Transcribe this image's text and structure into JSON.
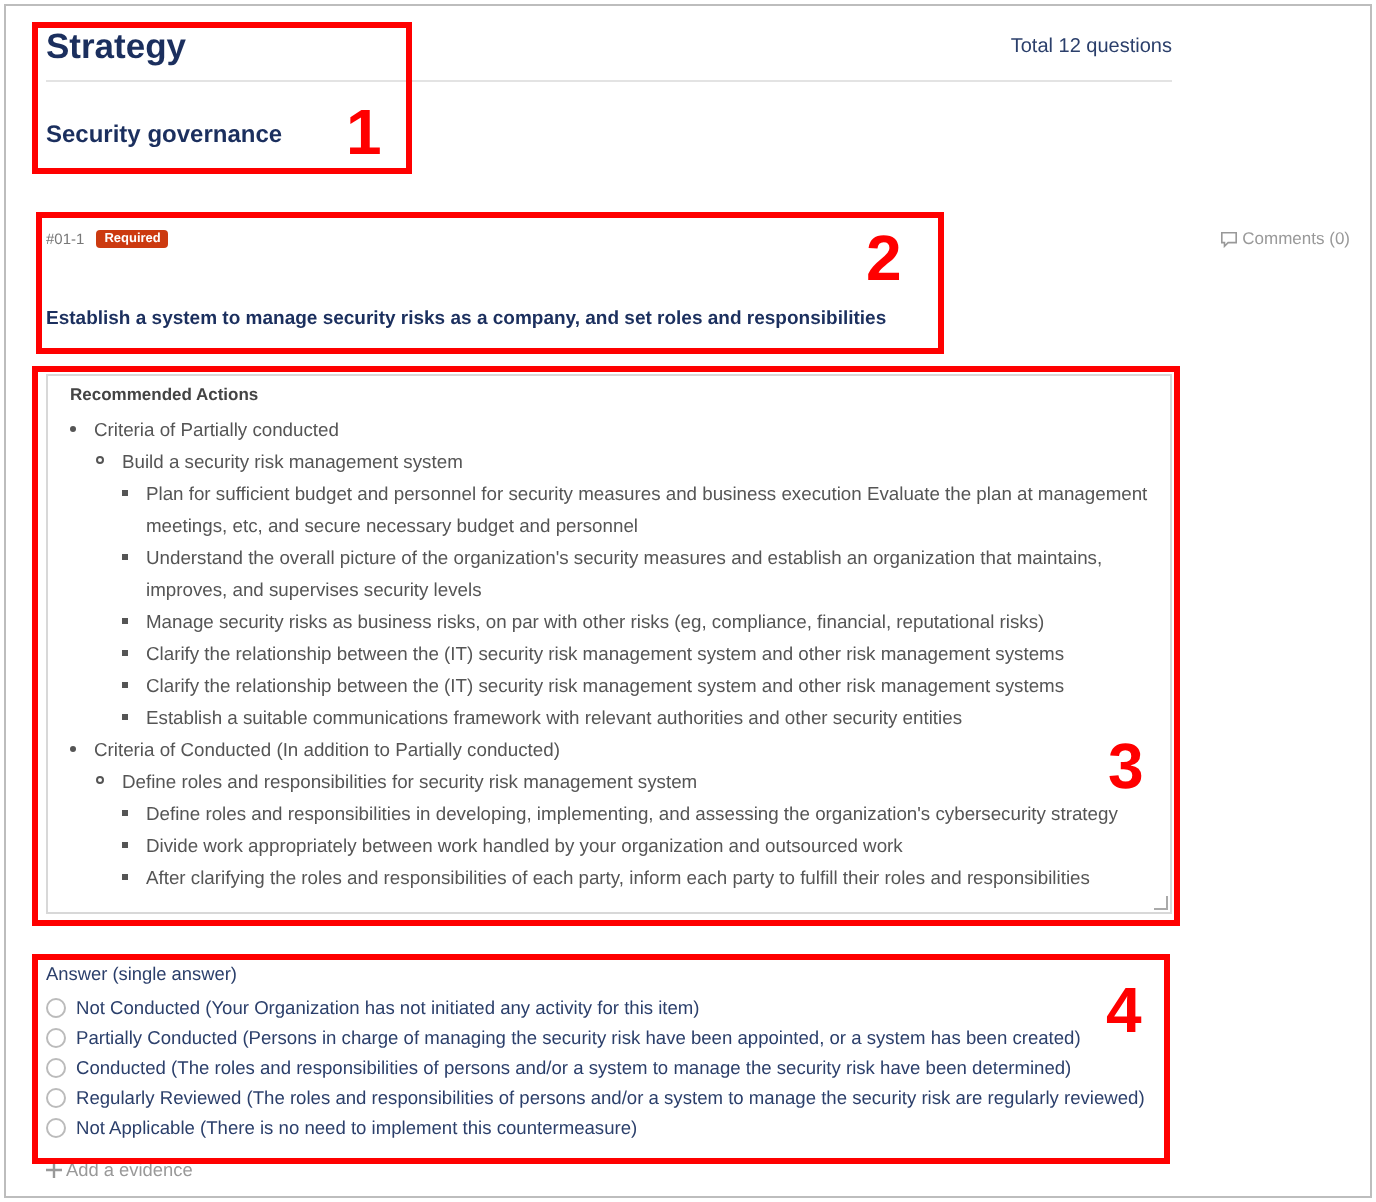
{
  "header": {
    "title": "Strategy",
    "total": "Total 12 questions",
    "subtitle": "Security governance"
  },
  "question": {
    "number": "#01-1",
    "badge": "Required",
    "comments": "Comments (0)",
    "text": "Establish a system to manage security risks as a company, and set roles and responsibilities"
  },
  "recommended": {
    "title": "Recommended Actions",
    "items": [
      {
        "text": "Criteria of Partially conducted",
        "children": [
          {
            "text": "Build a security risk management system",
            "children": [
              {
                "text": "Plan for sufficient budget and personnel for security measures and business execution Evaluate the plan at management meetings, etc, and secure necessary budget and personnel"
              },
              {
                "text": "Understand the overall picture of the organization's security measures and establish an organization that maintains, improves, and supervises security levels"
              },
              {
                "text": "Manage security risks as business risks, on par with other risks (eg, compliance, financial, reputational risks)"
              },
              {
                "text": "Clarify the relationship between the (IT) security risk management system and other risk management systems"
              },
              {
                "text": "Clarify the relationship between the (IT) security risk management system and other risk management systems"
              },
              {
                "text": "Establish a suitable communications framework with relevant authorities and other security entities"
              }
            ]
          }
        ]
      },
      {
        "text": "Criteria of Conducted (In addition to Partially conducted)",
        "children": [
          {
            "text": "Define roles and responsibilities for security risk management system",
            "children": [
              {
                "text": "Define roles and responsibilities in developing, implementing, and assessing the organization's cybersecurity strategy"
              },
              {
                "text": "Divide work appropriately between work handled by your organization and outsourced work"
              },
              {
                "text": "After clarifying the roles and responsibilities of each party, inform each party to fulfill their roles and responsibilities"
              }
            ]
          }
        ]
      }
    ]
  },
  "answer": {
    "label": "Answer (single answer)",
    "options": [
      {
        "text": "Not Conducted (Your Organization has not initiated any activity for this item)",
        "selected": false
      },
      {
        "text": "Partially Conducted (Persons in charge of managing the security risk have been appointed, or a system has been created)",
        "selected": false
      },
      {
        "text": "Conducted (The roles and responsibilities of persons and/or a system to manage the security risk have been determined)",
        "selected": false
      },
      {
        "text": "Regularly Reviewed (The roles and responsibilities of persons and/or a system to manage the security risk are regularly reviewed)",
        "selected": false
      },
      {
        "text": "Not Applicable (There is no need to implement this countermeasure)",
        "selected": false
      }
    ]
  },
  "add_evidence": "Add a evidence",
  "annotations": [
    {
      "label": "1"
    },
    {
      "label": "2"
    },
    {
      "label": "3"
    },
    {
      "label": "4"
    }
  ]
}
